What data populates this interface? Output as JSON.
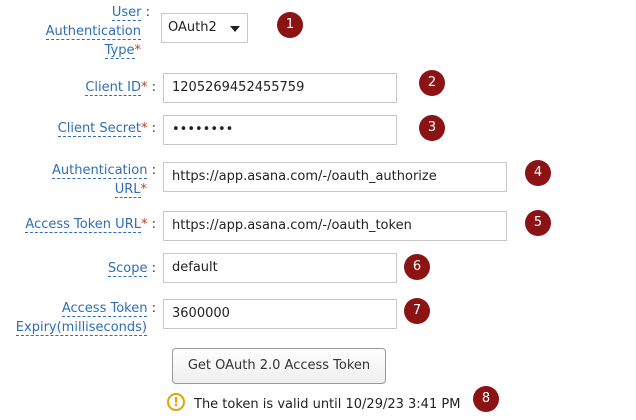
{
  "fields": {
    "auth_type": {
      "label_line1": "User",
      "label_line2": "Authentication",
      "label_line3": "Type",
      "required": "*",
      "value": "OAuth2",
      "badge": "1"
    },
    "client_id": {
      "label": "Client ID",
      "required": "*",
      "value": "1205269452455759",
      "badge": "2"
    },
    "client_secret": {
      "label": "Client Secret",
      "required": "*",
      "value": "••••••••",
      "badge": "3"
    },
    "auth_url": {
      "label_line1": "Authentication",
      "label_line2": "URL",
      "required": "*",
      "value": "https://app.asana.com/-/oauth_authorize",
      "badge": "4"
    },
    "access_token_url": {
      "label": "Access Token URL",
      "required": "*",
      "value": "https://app.asana.com/-/oauth_token",
      "badge": "5"
    },
    "scope": {
      "label": "Scope",
      "value": "default",
      "badge": "6"
    },
    "token_expiry": {
      "label_line1": "Access Token",
      "label_line2": "Expiry(milliseconds)",
      "value": "3600000",
      "badge": "7"
    }
  },
  "colon": ":",
  "get_token_button": {
    "label": "Get OAuth 2.0 Access Token"
  },
  "token_status": {
    "icon": "!",
    "text": "The token is valid until 10/29/23 3:41 PM",
    "badge": "8"
  }
}
